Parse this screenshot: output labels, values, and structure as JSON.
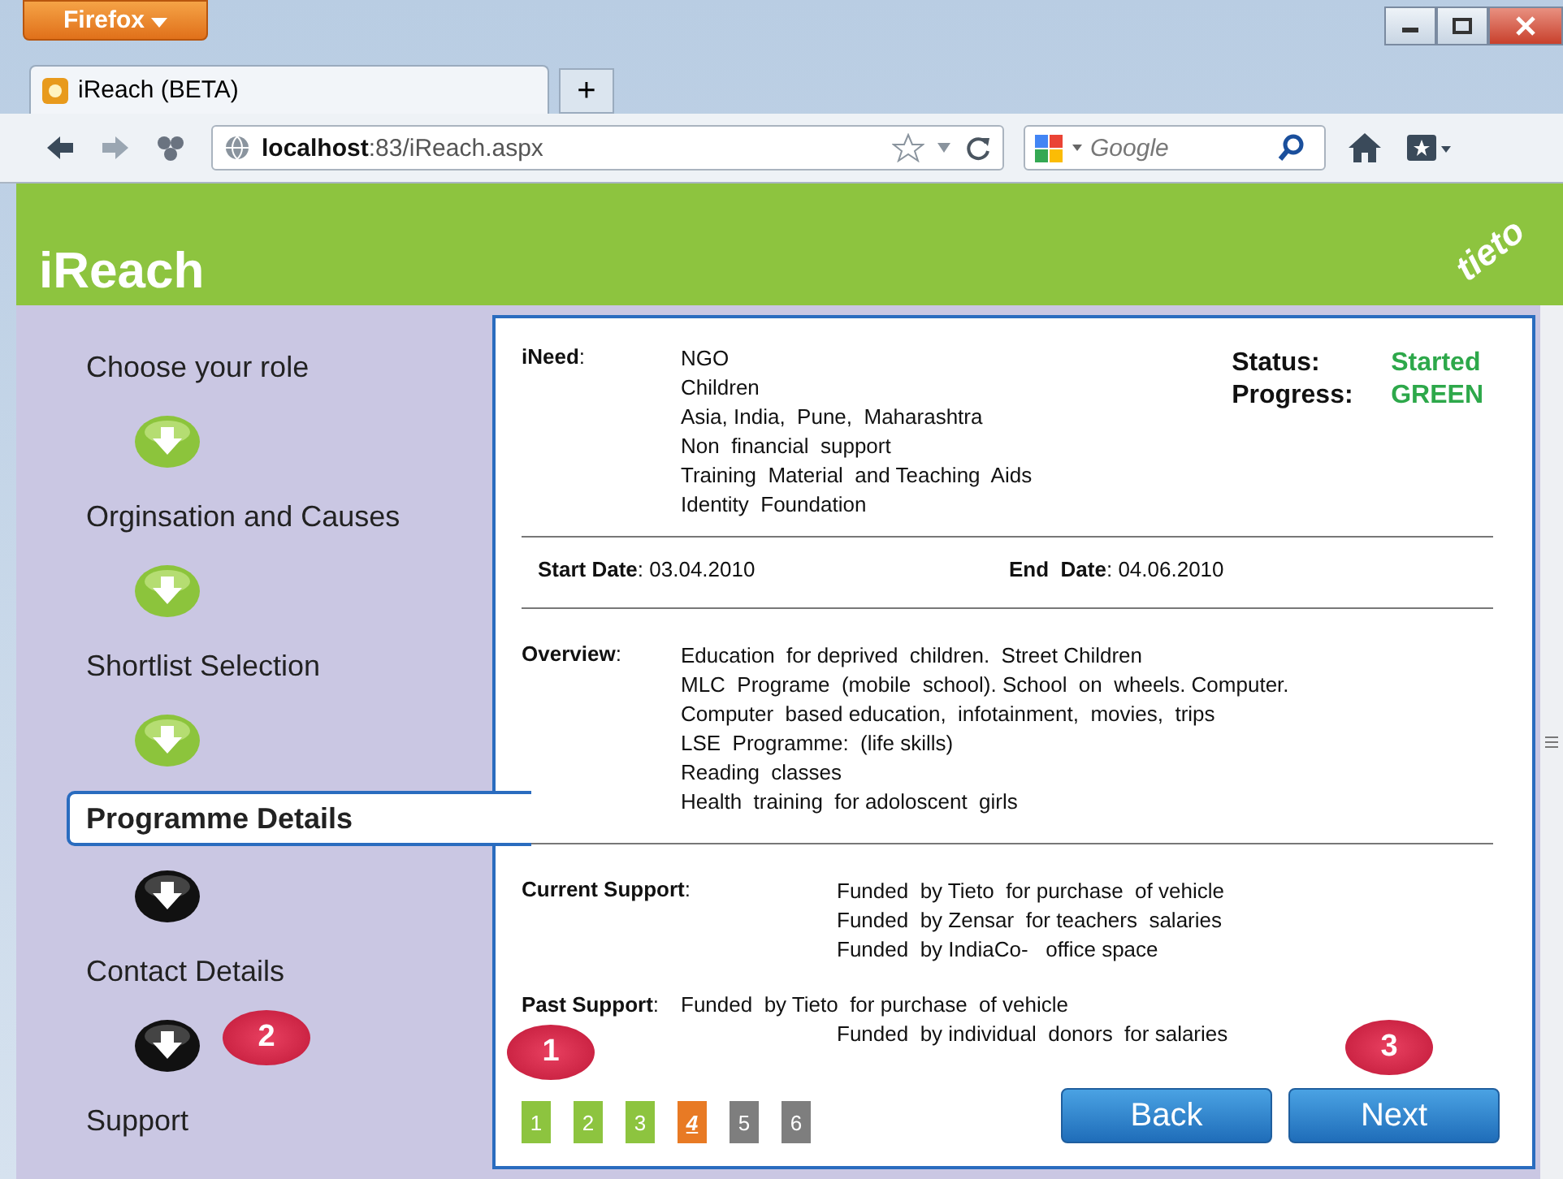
{
  "browser": {
    "menu_button": "Firefox",
    "tab_title": "iReach (BETA)",
    "new_tab": "+",
    "url": "**localhost**:83/iReach.aspx",
    "search_placeholder": "Google"
  },
  "header": {
    "title": "iReach",
    "logo": "tieto"
  },
  "steps": [
    {
      "label": "Choose your role",
      "selected": false,
      "completed": true
    },
    {
      "label": "Orginsation and Causes",
      "selected": false,
      "completed": true
    },
    {
      "label": "Shortlist Selection",
      "selected": false,
      "completed": true
    },
    {
      "label": "Programme Details",
      "selected": true,
      "completed": false
    },
    {
      "label": "Contact Details",
      "selected": false,
      "completed": false
    },
    {
      "label": "Support",
      "selected": false
    }
  ],
  "ineed": {
    "label": "**iNeed**:",
    "lines": [
      "NGO",
      "Children",
      "Asia, India,  Pune,  Maharashtra",
      "Non  financial  support",
      "Training  Material  and Teaching  Aids",
      "Identity  Foundation"
    ]
  },
  "status": [
    {
      "label": "Status:",
      "value": "Started"
    },
    {
      "label": "Progress:",
      "value": "GREEN"
    }
  ],
  "dates": [
    {
      "text": "**Start Date**: 03.04.2010"
    },
    {
      "text": "**End  Date**: 04.06.2010"
    }
  ],
  "overview": {
    "label": "**Overview**:",
    "lines": [
      "Education  for deprived  children.  Street Children",
      "MLC  Programe  (mobile  school). School  on  wheels. Computer.",
      "Computer  based education,  infotainment,  movies,  trips",
      "LSE  Programme:  (life skills)",
      "Reading  classes",
      "Health  training  for adoloscent  girls"
    ]
  },
  "current_support": {
    "label": "**Current Support**:",
    "lines": [
      "Funded  by Tieto  for purchase  of vehicle",
      "Funded  by Zensar  for teachers  salaries",
      "Funded  by IndiaCo-   office space"
    ]
  },
  "past_support": {
    "label": "**Past Support**:",
    "lines": [
      "Funded  by Tieto  for purchase  of vehicle",
      "Funded  by individual  donors  for salaries"
    ]
  },
  "pages": [
    {
      "label": "1",
      "selected": false,
      "completed": true
    },
    {
      "label": "2",
      "selected": false,
      "completed": true
    },
    {
      "label": "3",
      "selected": false,
      "completed": true
    },
    {
      "label": "4",
      "selected": true,
      "completed": false
    },
    {
      "label": "5",
      "selected": false,
      "completed": false
    },
    {
      "label": "6",
      "selected": false,
      "completed": false
    }
  ],
  "buttons": [
    "Back",
    "Next"
  ],
  "callouts": [
    {
      "label": "1",
      "kind": "pager"
    },
    {
      "label": "2",
      "kind": "sidebar"
    },
    {
      "label": "3",
      "kind": "next"
    }
  ]
}
